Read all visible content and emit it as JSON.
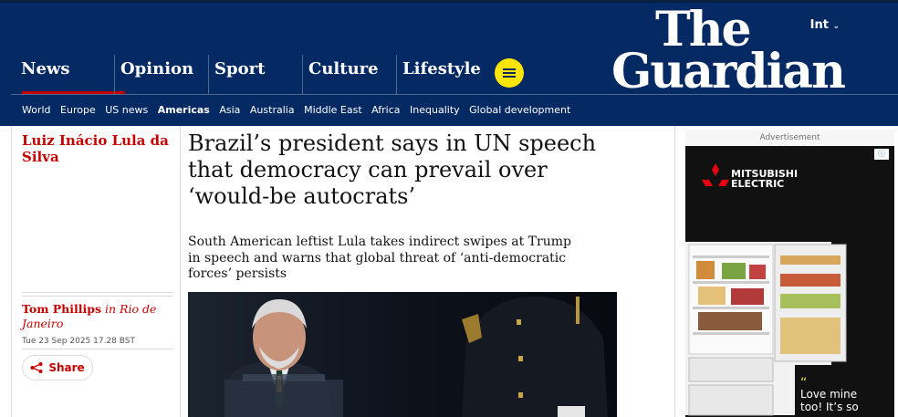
{
  "header": {
    "edition": "Int",
    "logo_line1": "The",
    "logo_line2": "Guardian",
    "pillars": [
      "News",
      "Opinion",
      "Sport",
      "Culture",
      "Lifestyle"
    ],
    "subnav": [
      "World",
      "Europe",
      "US news",
      "Americas",
      "Asia",
      "Australia",
      "Middle East",
      "Africa",
      "Inequality",
      "Global development"
    ],
    "subnav_active": "Americas"
  },
  "article": {
    "series_tag": "Luiz Inácio Lula da Silva",
    "headline": "Brazil’s president says in UN speech that democracy can prevail over ‘would-be autocrats’",
    "standfirst": "South American leftist Lula takes indirect swipes at Trump in speech and warns that global threat of ‘anti-democratic forces’ persists",
    "author": "Tom Phillips",
    "author_location": "in Rio de Janeiro",
    "dateline": "Tue 23 Sep 2025 17.28 BST",
    "share_label": "Share"
  },
  "ad": {
    "label": "Advertisement",
    "brand_line1": "MITSUBISHI",
    "brand_line2": "ELECTRIC",
    "quote_mark": "“",
    "quote_line1": "Love mine",
    "quote_line2": "too! It’s so"
  },
  "colors": {
    "brand_blue": "#052962",
    "news_red": "#c70000",
    "menu_yellow": "#ffe500"
  }
}
